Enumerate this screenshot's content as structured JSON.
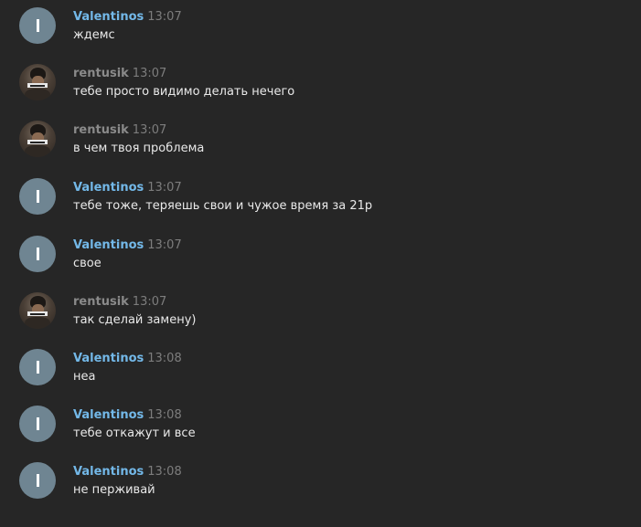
{
  "colors": {
    "background": "#262626",
    "valentinos_name": "#73b8e8",
    "rentusik_name": "#8a8a8a",
    "timestamp": "#7d7d7d",
    "message_text": "#e9e9e9",
    "letter_avatar": "#6f8592"
  },
  "messages": [
    {
      "author": "Valentinos",
      "time": "13:07",
      "text": "ждемс",
      "avatar": "letter-avatar",
      "avatar_letter": "I"
    },
    {
      "author": "rentusik",
      "time": "13:07",
      "text": "тебе просто видимо делать нечего",
      "avatar": "photo-avatar"
    },
    {
      "author": "rentusik",
      "time": "13:07",
      "text": "в чем твоя проблема",
      "avatar": "photo-avatar"
    },
    {
      "author": "Valentinos",
      "time": "13:07",
      "text": "тебе тоже, теряешь свои и чужое время за 21р",
      "avatar": "letter-avatar",
      "avatar_letter": "I"
    },
    {
      "author": "Valentinos",
      "time": "13:07",
      "text": "свое",
      "avatar": "letter-avatar",
      "avatar_letter": "I"
    },
    {
      "author": "rentusik",
      "time": "13:07",
      "text": "так сделай замену)",
      "avatar": "photo-avatar"
    },
    {
      "author": "Valentinos",
      "time": "13:08",
      "text": "неа",
      "avatar": "letter-avatar",
      "avatar_letter": "I"
    },
    {
      "author": "Valentinos",
      "time": "13:08",
      "text": "тебе откажут и все",
      "avatar": "letter-avatar",
      "avatar_letter": "I"
    },
    {
      "author": "Valentinos",
      "time": "13:08",
      "text": "не перживай",
      "avatar": "letter-avatar",
      "avatar_letter": "I"
    }
  ]
}
